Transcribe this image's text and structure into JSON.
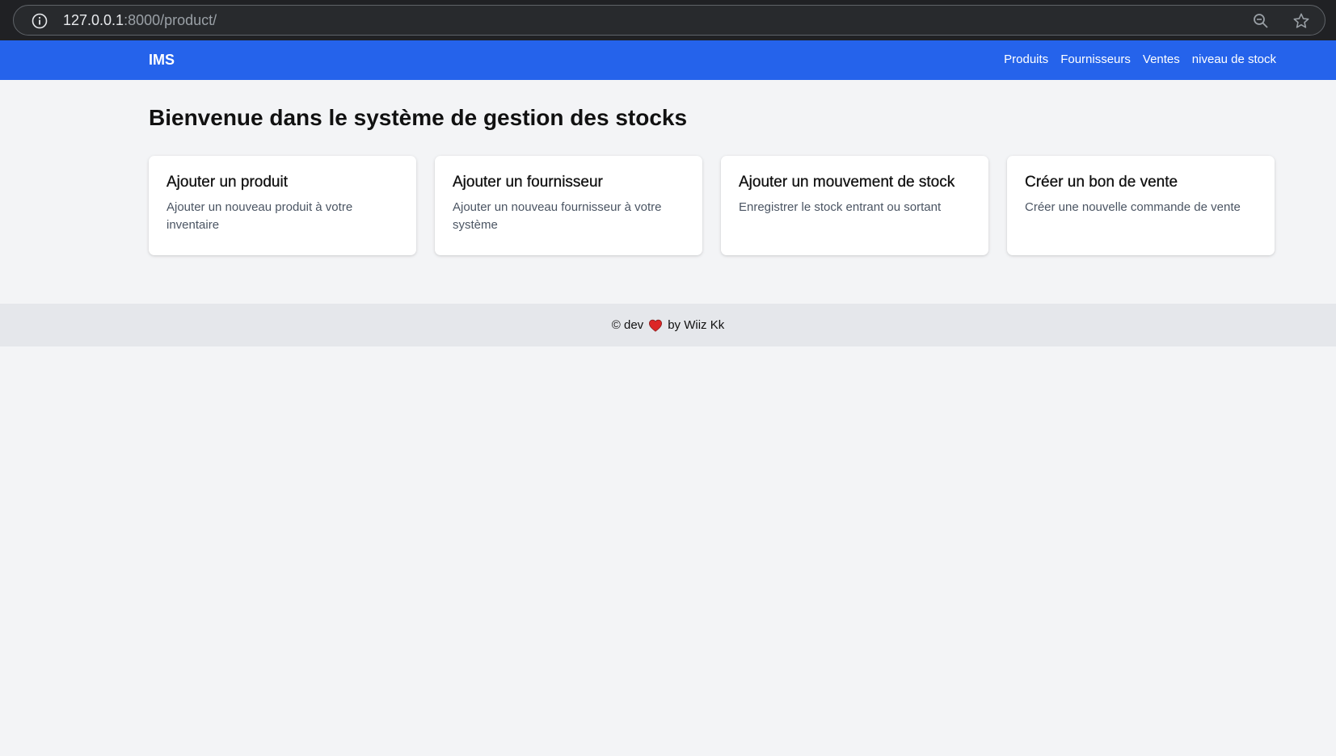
{
  "browser": {
    "url_host": "127.0.0.1",
    "url_rest": ":8000/product/",
    "icons": {
      "info": "info-icon",
      "zoom": "zoom-out-icon",
      "bookmark": "star-icon"
    }
  },
  "navbar": {
    "brand": "IMS",
    "links": [
      "Produits",
      "Fournisseurs",
      "Ventes",
      "niveau de stock"
    ],
    "color": "#2563eb"
  },
  "main": {
    "title": "Bienvenue dans le système de gestion des stocks",
    "cards": [
      {
        "title": "Ajouter un produit",
        "description": "Ajouter un nouveau produit à votre inventaire"
      },
      {
        "title": "Ajouter un fournisseur",
        "description": "Ajouter un nouveau fournisseur à votre système"
      },
      {
        "title": "Ajouter un mouvement de stock",
        "description": "Enregistrer le stock entrant ou sortant"
      },
      {
        "title": "Créer un bon de vente",
        "description": "Créer une nouvelle commande de vente"
      }
    ]
  },
  "footer": {
    "prefix": "© dev",
    "icon": "heart-icon",
    "suffix": "by Wiiz Kk",
    "heart_color": "#dc2626"
  }
}
